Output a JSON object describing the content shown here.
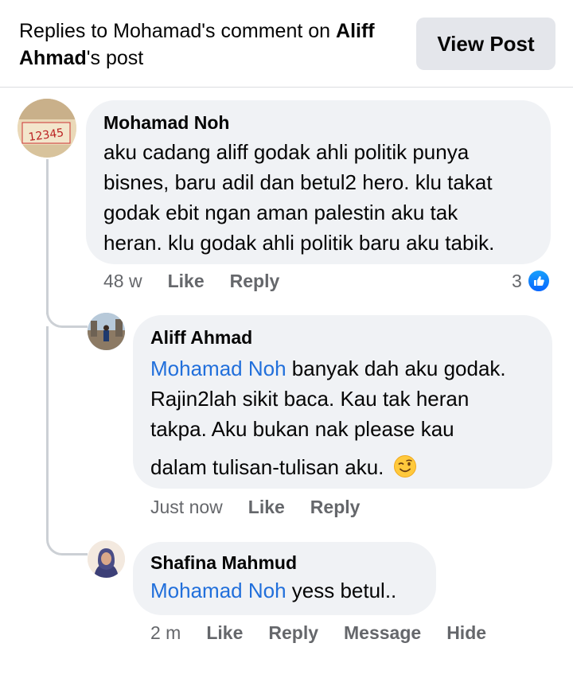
{
  "header": {
    "title_part1": "Replies to Mohamad's comment on ",
    "title_bold_name": "Aliff",
    "title_line2_bold": "Ahmad",
    "title_line2_rest": "'s post",
    "view_post_label": "View Post"
  },
  "comments": [
    {
      "author": "Mohamad Noh",
      "text_lines": [
        "aku cadang aliff godak ahli politik punya",
        "bisnes, baru adil dan betul2 hero. klu takat",
        "godak ebit ngan aman palestin aku tak",
        "heran. klu godak ahli politik baru aku tabik."
      ],
      "time": "48 w",
      "like_label": "Like",
      "reply_label": "Reply",
      "reaction_count": "3",
      "avatar_text": "12345"
    },
    {
      "author": "Aliff Ahmad",
      "mention": "Mohamad Noh",
      "text_line1_rest": " banyak dah aku godak.",
      "text_lines": [
        "Rajin2lah sikit baca. Kau tak heran",
        "takpa. Aku bukan nak please kau"
      ],
      "text_last": "dalam tulisan-tulisan aku.",
      "time": "Just now",
      "like_label": "Like",
      "reply_label": "Reply"
    },
    {
      "author": "Shafina Mahmud",
      "mention": "Mohamad Noh",
      "text_rest": " yess betul..",
      "time": "2 m",
      "like_label": "Like",
      "reply_label": "Reply",
      "message_label": "Message",
      "hide_label": "Hide"
    }
  ],
  "colors": {
    "mention": "#216fdb",
    "bubble": "#f0f2f5",
    "meta": "#65676b",
    "like_badge": "#0866ff"
  },
  "icons": [
    "like-reaction-icon",
    "winking-face-emoji"
  ]
}
